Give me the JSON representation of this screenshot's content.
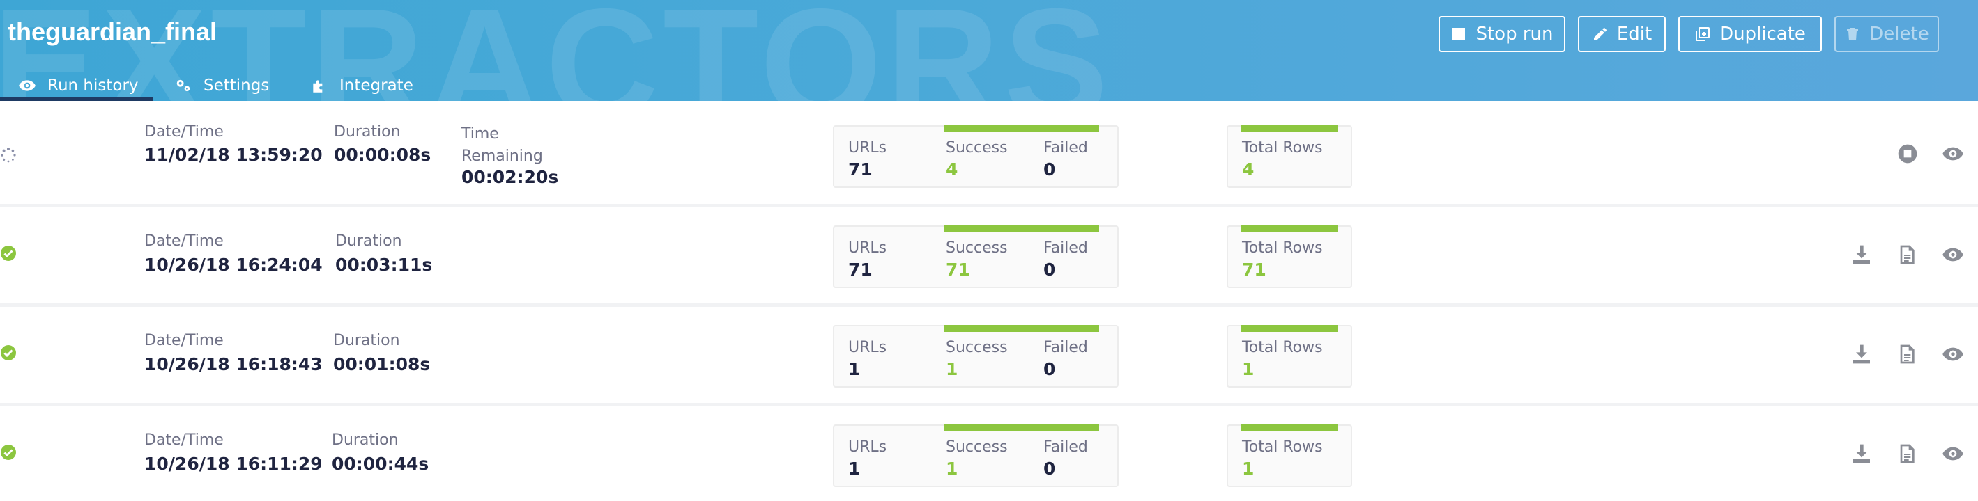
{
  "header": {
    "watermark": "EXTRACTORS",
    "title": "theguardian_final",
    "tabs": [
      {
        "label": "Run history",
        "icon": "eye-icon",
        "active": true
      },
      {
        "label": "Settings",
        "icon": "gears-icon",
        "active": false
      },
      {
        "label": "Integrate",
        "icon": "puzzle-icon",
        "active": false
      }
    ],
    "buttons": {
      "stop_run": "Stop run",
      "edit": "Edit",
      "duplicate": "Duplicate",
      "delete": "Delete"
    }
  },
  "labels": {
    "datetime": "Date/Time",
    "duration": "Duration",
    "time_remaining": "Time Remaining",
    "urls": "URLs",
    "success": "Success",
    "failed": "Failed",
    "total_rows": "Total Rows"
  },
  "colors": {
    "accent_green": "#8cc63f",
    "header_blue": "#4aa9d8",
    "tab_underline": "#1e3a63"
  },
  "runs": [
    {
      "status": "running",
      "datetime": "11/02/18 13:59:20",
      "duration": "00:00:08s",
      "time_remaining": "00:02:20s",
      "urls": "71",
      "success": "4",
      "failed": "0",
      "total_rows": "4"
    },
    {
      "status": "success",
      "datetime": "10/26/18 16:24:04",
      "duration": "00:03:11s",
      "urls": "71",
      "success": "71",
      "failed": "0",
      "total_rows": "71"
    },
    {
      "status": "success",
      "datetime": "10/26/18 16:18:43",
      "duration": "00:01:08s",
      "urls": "1",
      "success": "1",
      "failed": "0",
      "total_rows": "1"
    },
    {
      "status": "success",
      "datetime": "10/26/18 16:11:29",
      "duration": "00:00:44s",
      "urls": "1",
      "success": "1",
      "failed": "0",
      "total_rows": "1"
    }
  ]
}
